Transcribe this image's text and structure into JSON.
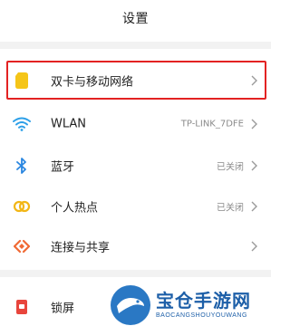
{
  "header": {
    "title": "设置"
  },
  "settings": {
    "items": [
      {
        "label": "双卡与移动网络",
        "value": "",
        "icon": "sim-card-icon"
      },
      {
        "label": "WLAN",
        "value": "TP-LINK_7DFE",
        "icon": "wifi-icon"
      },
      {
        "label": "蓝牙",
        "value": "已关闭",
        "icon": "bluetooth-icon"
      },
      {
        "label": "个人热点",
        "value": "已关闭",
        "icon": "hotspot-icon"
      },
      {
        "label": "连接与共享",
        "value": "",
        "icon": "connection-share-icon"
      },
      {
        "label": "锁屏",
        "value": "",
        "icon": "lock-screen-icon"
      }
    ]
  },
  "watermark": {
    "main": "宝仓手游网",
    "sub": "BAOCANGSHOUYOUWANG"
  },
  "colors": {
    "highlight": "#e32222",
    "sim_icon": "#f5c518",
    "wifi_icon": "#2ea0e8",
    "bluetooth_icon": "#2a86e0",
    "hotspot_icon": "#f2b616",
    "share_icon": "#f06a35",
    "lock_icon": "#e8453c"
  }
}
